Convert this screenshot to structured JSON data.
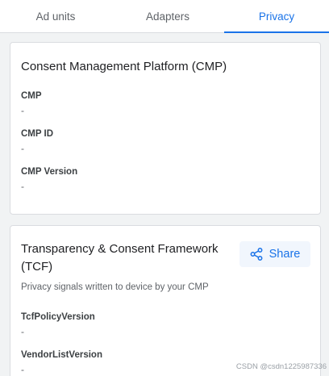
{
  "tabs": [
    {
      "label": "Ad units"
    },
    {
      "label": "Adapters"
    },
    {
      "label": "Privacy",
      "selected": true
    }
  ],
  "cmp_card": {
    "title": "Consent Management Platform (CMP)",
    "fields": [
      {
        "label": "CMP",
        "value": "-"
      },
      {
        "label": "CMP ID",
        "value": "-"
      },
      {
        "label": "CMP Version",
        "value": "-"
      }
    ]
  },
  "tcf_card": {
    "title": "Transparency & Consent Framework (TCF)",
    "share_label": "Share",
    "description": "Privacy signals written to device by your CMP",
    "fields": [
      {
        "label": "TcfPolicyVersion",
        "value": "-"
      },
      {
        "label": "VendorListVersion",
        "value": "-"
      }
    ]
  },
  "watermark": "CSDN @csdn1225987336",
  "icons": {
    "share": "share-icon"
  },
  "colors": {
    "accent": "#1a73e8",
    "background": "#f1f3f4",
    "card": "#ffffff"
  }
}
